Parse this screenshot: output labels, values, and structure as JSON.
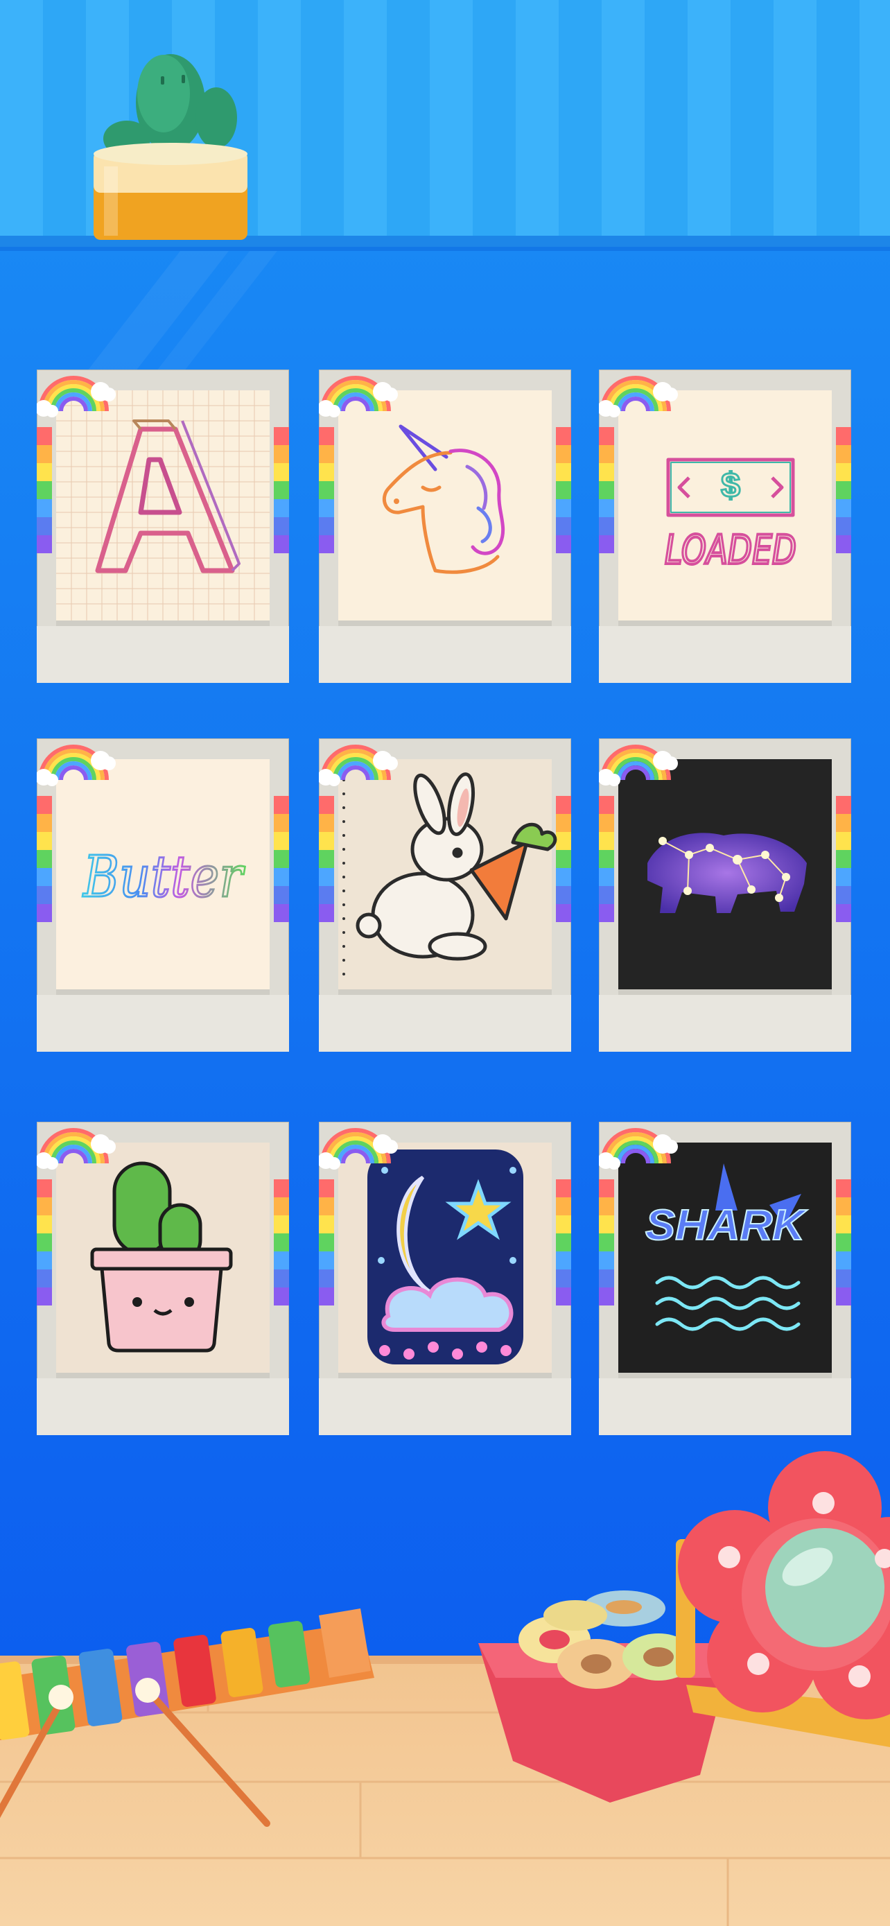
{
  "scene": {
    "shelf_decor": "cactus-pot",
    "floor_decor": [
      "xylophone",
      "bowl-of-rings",
      "flower-mirror"
    ],
    "colors": {
      "wall_top": "#2ea6f5",
      "wall_bottom": "#0a59ee",
      "floor": "#f5c995",
      "rainbow": [
        "#ff6b6b",
        "#ffb347",
        "#ffe34d",
        "#5fd35f",
        "#4da6ff",
        "#7c6cf0",
        "#b560e8"
      ]
    }
  },
  "gallery": {
    "cards": [
      {
        "id": "letter-a",
        "art": "glitter-letter-a",
        "paper": "grid"
      },
      {
        "id": "unicorn",
        "art": "neon-unicorn",
        "paper": "cream"
      },
      {
        "id": "loaded",
        "art": "money-loaded",
        "paper": "cream",
        "text": "LOADED",
        "symbol": "$"
      },
      {
        "id": "butter",
        "art": "rainbow-script",
        "paper": "cream",
        "text": "Butter"
      },
      {
        "id": "bunny",
        "art": "bunny-with-carrot",
        "paper": "notebook"
      },
      {
        "id": "bear",
        "art": "constellation-bear",
        "paper": "dark"
      },
      {
        "id": "cactus",
        "art": "kawaii-cactus",
        "paper": "beige"
      },
      {
        "id": "moon",
        "art": "moon-star-cloud",
        "paper": "beige"
      },
      {
        "id": "shark",
        "art": "neon-shark",
        "paper": "dark",
        "text": "SHARK"
      }
    ]
  }
}
